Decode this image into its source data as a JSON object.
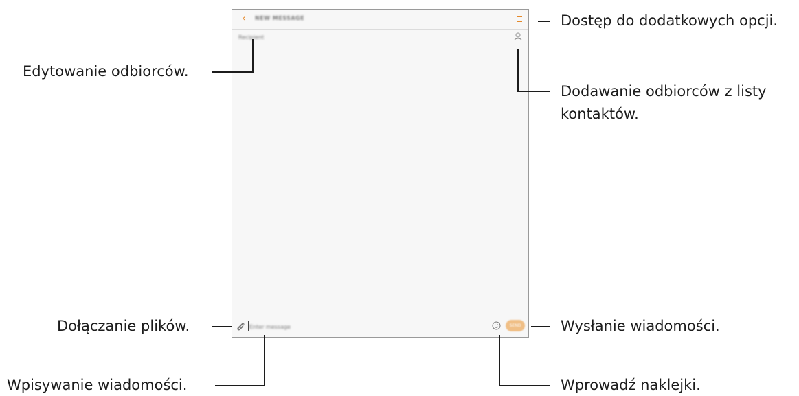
{
  "screen": {
    "title": "NEW MESSAGE",
    "recipient_placeholder": "Recipient",
    "message_placeholder": "Enter message",
    "send_label": "SEND",
    "accent_color": "#e58a2c",
    "send_color": "#f0bf86",
    "icons": [
      "back-icon",
      "more-options-icon",
      "contacts-icon",
      "attach-icon",
      "sticker-icon"
    ]
  },
  "callouts": {
    "more_options": "Dostęp do dodatkowych opcji.",
    "edit_recipients": "Edytowanie odbiorców.",
    "add_contacts_line1": "Dodawanie odbiorców z listy",
    "add_contacts_line2": "kontaktów.",
    "attach_files": "Dołączanie plików.",
    "send_message": "Wysłanie wiadomości.",
    "enter_message": "Wpisywanie wiadomości.",
    "stickers": "Wprowadź naklejki."
  }
}
